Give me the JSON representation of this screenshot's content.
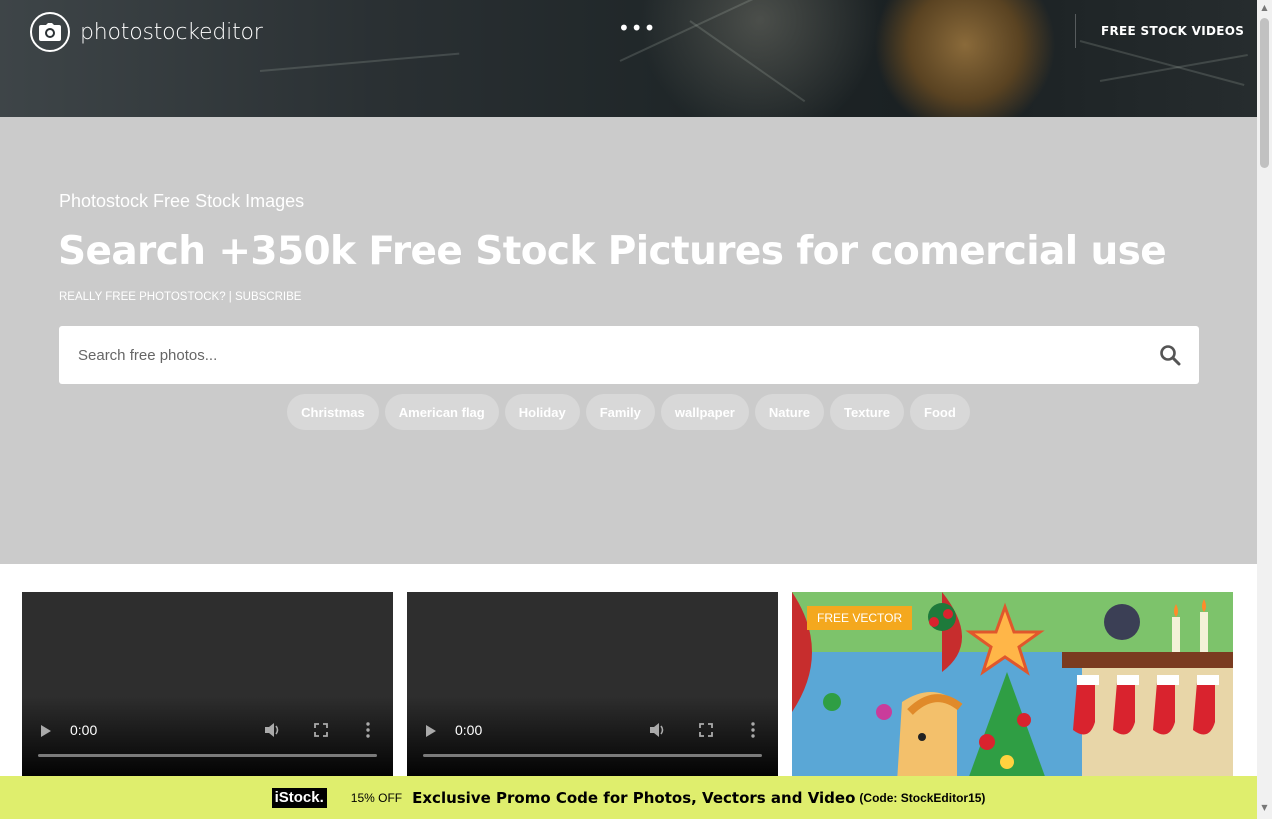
{
  "header": {
    "logo_text": "photostockeditor",
    "menu_dots": "•••",
    "videos_link": "FREE STOCK VIDEOS"
  },
  "hero": {
    "subtitle": "Photostock Free Stock Images",
    "title": "Search +350k Free Stock Pictures for comercial use",
    "link_really_free": "REALLY FREE PHOTOSTOCK?",
    "link_separator": " | ",
    "link_subscribe": "SUBSCRIBE",
    "search_placeholder": "Search free photos...",
    "tags": [
      "Christmas",
      "American flag",
      "Holiday",
      "Family",
      "wallpaper",
      "Nature",
      "Texture",
      "Food"
    ]
  },
  "cards": {
    "video1_time": "0:00",
    "video2_time": "0:00",
    "vector_badge": "FREE VECTOR"
  },
  "promo": {
    "brand": "iStock.",
    "off": "15% OFF",
    "main": "Exclusive Promo Code for Photos, Vectors and Video",
    "code": "(Code: StockEditor15)"
  },
  "colors": {
    "hero_bg": "#cbcbcb",
    "promo_bg": "#dfee6d",
    "badge": "#f4a81e"
  }
}
